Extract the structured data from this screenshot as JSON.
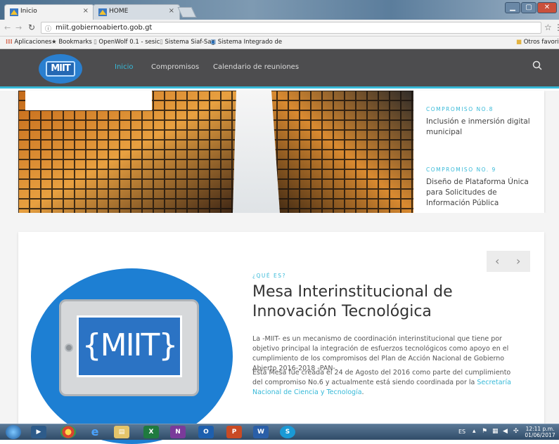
{
  "browser": {
    "tabs": [
      {
        "title": "Inicio",
        "icon": "guatemala-favicon",
        "active": true
      },
      {
        "title": "HOME",
        "icon": "guatemala-favicon",
        "active": false
      }
    ],
    "close_glyph": "×",
    "url": "miit.gobiernoabierto.gob.gt",
    "bookmarks": [
      {
        "label": "Aplicaciones",
        "icon": "apps-icon"
      },
      {
        "label": "Bookmarks",
        "icon": "star-icon"
      },
      {
        "label": "OpenWolf 0.1 - sesic",
        "icon": "page-icon"
      },
      {
        "label": "Sistema Siaf-Sag",
        "icon": "page-icon"
      },
      {
        "label": "Sistema Integrado de",
        "icon": "app-icon"
      }
    ],
    "other_bookmarks": "Otros favoritos"
  },
  "site": {
    "logo_text": "MIIT",
    "nav": [
      {
        "label": "Inicio",
        "active": true
      },
      {
        "label": "Compromisos",
        "active": false
      },
      {
        "label": "Calendario de reuniones",
        "active": false
      }
    ],
    "accent": "#36b9d8"
  },
  "hero": {
    "commitments": [
      {
        "kicker": "COMPROMISO NO.8",
        "title": "Inclusión e inmersión digital municipal"
      },
      {
        "kicker": "COMPROMISO NO. 9",
        "title": "Diseño de Plataforma Única para Solicitudes de Información Pública"
      }
    ]
  },
  "about": {
    "kicker": "¿QUÉ ES?",
    "title": "Mesa Interinstitucional de Innovación Tecnológica",
    "logo_text": "{MIIT}",
    "para1": "La -MIIT- es un mecanismo de coordinación interinstitucional que tiene por objetivo principal la integración de esfuerzos tecnológicos como apoyo en el cumplimiento de los compromisos del Plan de Acción Nacional de Gobierno Abierto 2016-2018 -PAN-.",
    "para2_text": "Esta Mesa fue creada el 24 de Agosto del 2016 como parte del cumplimiento del compromiso No.6 y actualmente está siendo coordinada por la ",
    "para2_link": "Secretaría Nacional de Ciencia y Tecnología",
    "para2_end": ".",
    "prev_glyph": "‹",
    "next_glyph": "›"
  },
  "taskbar": {
    "language": "ES",
    "time": "12:11 p.m.",
    "date": "01/06/2017"
  }
}
